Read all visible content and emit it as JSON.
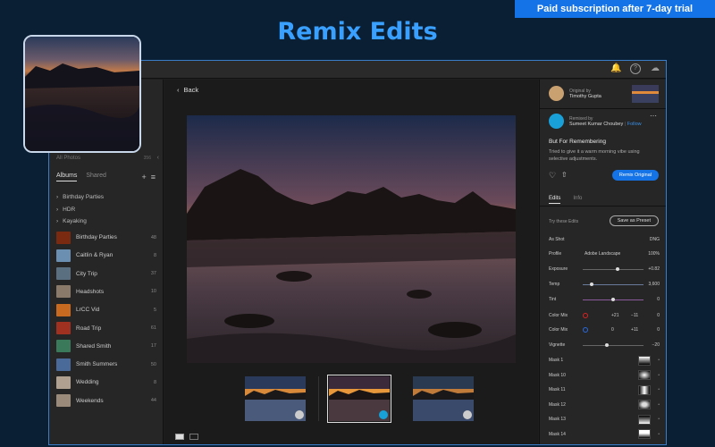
{
  "banner": "Paid subscription after 7-day trial",
  "headline": "Remix Edits",
  "sidebar": {
    "hidden_label": "All Photos",
    "hidden_count": "356",
    "tabs": [
      "Albums",
      "Shared"
    ],
    "folders": [
      "Birthday Parties",
      "HDR",
      "Kayaking"
    ],
    "albums": [
      {
        "label": "Birthday Parties",
        "count": "48",
        "color": "#7a2a10"
      },
      {
        "label": "Caitlin & Ryan",
        "count": "8",
        "color": "#6a8fb0"
      },
      {
        "label": "City Trip",
        "count": "37",
        "color": "#5a6f80"
      },
      {
        "label": "Headshots",
        "count": "10",
        "color": "#8a7a6a"
      },
      {
        "label": "LrCC Vid",
        "count": "5",
        "color": "#c86b20"
      },
      {
        "label": "Road Trip",
        "count": "61",
        "color": "#a03020"
      },
      {
        "label": "Shared Smith",
        "count": "17",
        "color": "#3a7a5a"
      },
      {
        "label": "Smith Summers",
        "count": "50",
        "color": "#4a6a9a"
      },
      {
        "label": "Wedding",
        "count": "8",
        "color": "#b0a090"
      },
      {
        "label": "Weekends",
        "count": "44",
        "color": "#9a8a7a"
      }
    ]
  },
  "center": {
    "back_label": "Back"
  },
  "right": {
    "original_by": "Original by",
    "original_name": "Timothy Gupta",
    "remixed_by": "Remixed by",
    "remixed_name": "Sumeet Kumar Choubey",
    "follow": "Follow",
    "remix_title": "But For Remembering",
    "remix_desc": "Tried to give it a warm morning vibe using selective adjustments.",
    "remix_button": "Remix Original",
    "tabs": [
      "Edits",
      "Info"
    ],
    "try_label": "Try these Edits",
    "preset_button": "Save as Preset",
    "as_shot": "As Shot",
    "as_shot_value": "DNG",
    "profile_label": "Profile",
    "profile_value": "Adobe Landscape",
    "profile_amount": "100%",
    "sliders": [
      {
        "label": "Exposure",
        "value": "+0.82",
        "pos": 0.58,
        "color": "#666"
      },
      {
        "label": "Temp",
        "value": "3,600",
        "pos": 0.15,
        "color": "#6a7a9a"
      },
      {
        "label": "Tint",
        "value": "0",
        "pos": 0.5,
        "color": "#8a5a9a"
      }
    ],
    "colormix": [
      {
        "label": "Color Mix",
        "v1": "+21",
        "v2": "−11",
        "v3": "0",
        "ring": "#d22"
      },
      {
        "label": "Color Mix",
        "v1": "0",
        "v2": "+11",
        "v3": "0",
        "ring": "#2a6ae0"
      }
    ],
    "vignette": {
      "label": "Vignette",
      "value": "−20",
      "pos": 0.4
    },
    "masks": [
      "Mask 1",
      "Mask 10",
      "Mask 11",
      "Mask 12",
      "Mask 13",
      "Mask 14"
    ]
  }
}
